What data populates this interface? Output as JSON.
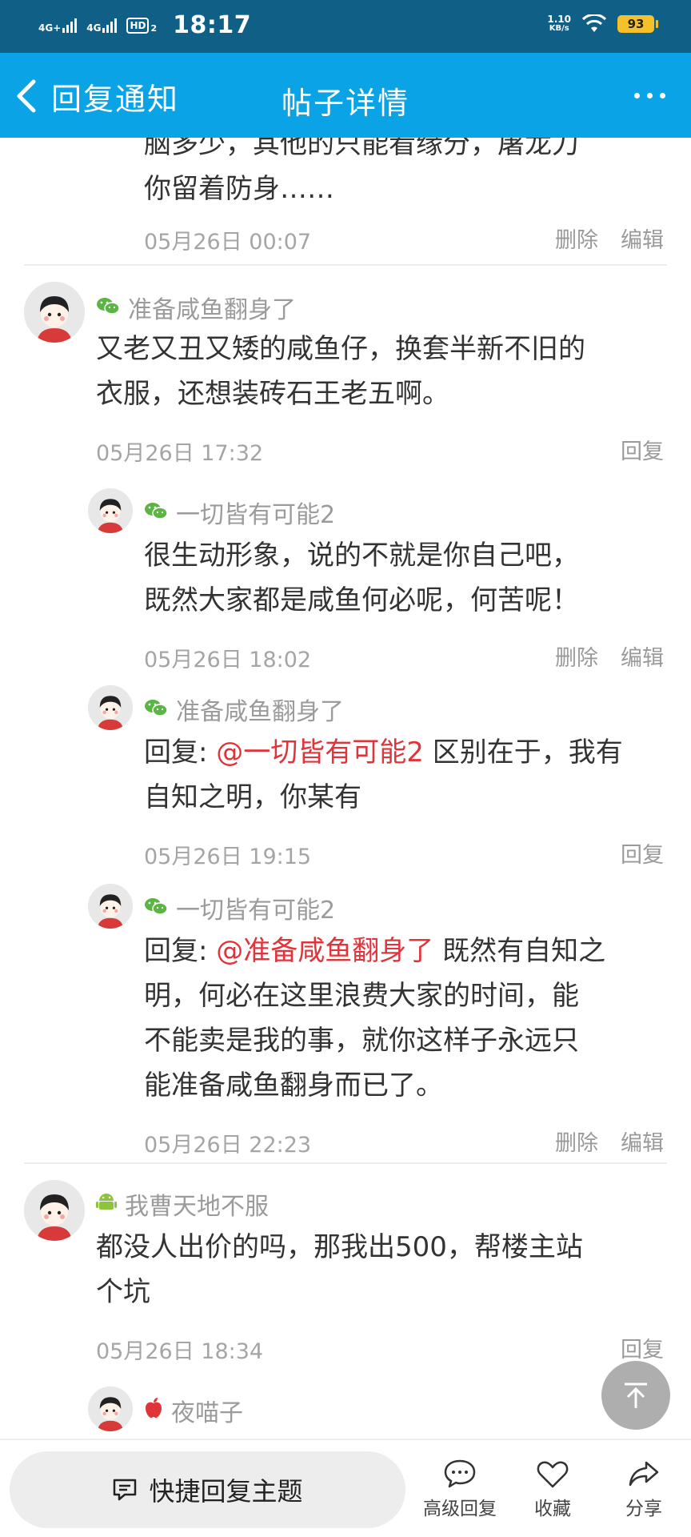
{
  "status_bar": {
    "net1": "4G+",
    "net2": "4G",
    "hd": "HD",
    "hd_sub": "2",
    "time": "18:17",
    "speed_value": "1.10",
    "speed_unit": "KB/s",
    "battery": "93"
  },
  "nav": {
    "back_label": "回复通知",
    "title": "帖子详情"
  },
  "top_fragment": {
    "line1": "脑多少，其他的只能看缘分，屠龙刀",
    "line2": "你留着防身……",
    "time": "05月26日 00:07",
    "delete_label": "删除",
    "edit_label": "编辑"
  },
  "comments": [
    {
      "user": "准备咸鱼翻身了",
      "platform": "wechat-icon",
      "text_line1": "又老又丑又矮的咸鱼仔，换套半新不旧的",
      "text_line2": "衣服，还想装砖石王老五啊。",
      "time": "05月26日 17:32",
      "reply_label": "回复",
      "replies": [
        {
          "user": "一切皆有可能2",
          "platform": "wechat-icon",
          "line1": "很生动形象，说的不就是你自己吧，",
          "line2": "既然大家都是咸鱼何必呢，何苦呢！",
          "time": "05月26日 18:02",
          "delete_label": "删除",
          "edit_label": "编辑"
        },
        {
          "user": "准备咸鱼翻身了",
          "platform": "wechat-icon",
          "prefix": "回复: ",
          "mention": "@一切皆有可能2",
          "line1_rest": " 区别在于，我有",
          "line2": "自知之明，你某有",
          "time": "05月26日 19:15",
          "reply_label": "回复"
        },
        {
          "user": "一切皆有可能2",
          "platform": "wechat-icon",
          "prefix": "回复: ",
          "mention": "@准备咸鱼翻身了",
          "line1_rest": " 既然有自知之",
          "line2": "明，何必在这里浪费大家的时间，能",
          "line3": "不能卖是我的事，就你这样子永远只",
          "line4": "能准备咸鱼翻身而已了。",
          "time": "05月26日 22:23",
          "delete_label": "删除",
          "edit_label": "编辑"
        }
      ]
    },
    {
      "user": "我曹天地不服",
      "platform": "android-icon",
      "text_line1": "都没人出价的吗，那我出500，帮楼主站",
      "text_line2": "个坑",
      "time": "05月26日 18:34",
      "reply_label": "回复",
      "replies": [
        {
          "user": "夜喵子",
          "platform": "apple-icon"
        }
      ]
    }
  ],
  "bottom_bar": {
    "quick_reply": "快捷回复主题",
    "advanced_reply": "高级回复",
    "favorite": "收藏",
    "share": "分享"
  },
  "colors": {
    "status_bar": "#0f5f86",
    "nav_bar": "#0aa3e6",
    "mention": "#e0343b",
    "wechat": "#5bb543",
    "android": "#8cc43f",
    "apple": "#e0343b"
  }
}
